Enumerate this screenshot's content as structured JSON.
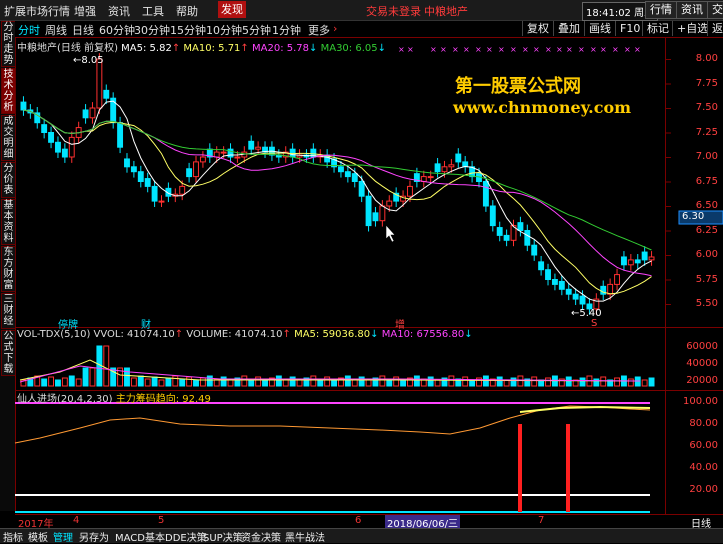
{
  "menubar": {
    "items": [
      "扩展市场行情",
      "增强",
      "资讯",
      "工具",
      "帮助"
    ],
    "active_item": "发现",
    "login_notice": "交易未登录",
    "stock_name_title": "中粮地产",
    "clock": "18:41:02",
    "weekday": "周三",
    "buttons": [
      "行情",
      "资讯",
      "交"
    ]
  },
  "periodbar": {
    "periods": [
      "分时",
      "周线",
      "日线",
      "60分钟",
      "30分钟",
      "15分钟",
      "10分钟",
      "5分钟",
      "1分钟",
      "更多"
    ],
    "selected": "日线",
    "buttons": [
      "复权",
      "叠加",
      "画线",
      "F10",
      "标记",
      "+自选",
      "返回"
    ]
  },
  "left_tabs": [
    "分时走势",
    "技术分析",
    "成交明细",
    "分价表",
    "基本资料",
    "东方财富",
    "三财经",
    "公式下载"
  ],
  "main_legend": {
    "title": "中粮地产(日线 前复权)",
    "ma5": "MA5: 5.82",
    "ma10": "MA10: 5.71",
    "ma20": "MA20: 5.78",
    "ma30": "MA30: 6.05"
  },
  "vol_legend": {
    "title": "VOL-TDX(5,10)",
    "vvol": "VVOL: 41074.10",
    "volume": "VOLUME: 41074.10",
    "ma5": "MA5: 59036.80",
    "ma10": "MA10: 67556.80"
  },
  "ind_legend": {
    "title": "仙人进场(20,4,2,30)",
    "sub": "主力筹码趋向: 92.49"
  },
  "annotations": {
    "high_label": "8.05",
    "low_label": "5.40",
    "current_price": "6.30",
    "event_1": "停牌",
    "event_2": "财",
    "event_3": "增",
    "signal_s": "S"
  },
  "watermark": {
    "line1": "第一股票公式网",
    "line2": "www.chnmoney.com"
  },
  "price_axis": [
    "8.00",
    "7.75",
    "7.50",
    "7.25",
    "7.00",
    "6.75",
    "6.50",
    "6.25",
    "6.00",
    "5.75",
    "5.50"
  ],
  "vol_axis": [
    "60000",
    "40000",
    "20000"
  ],
  "ind_axis": [
    "100.00",
    "80.00",
    "60.00",
    "40.00",
    "20.00"
  ],
  "datebar": {
    "labels": [
      "2017年",
      "4",
      "5",
      "6",
      "7"
    ],
    "highlight": "2018/06/06/三",
    "right_label": "日线"
  },
  "bottom_tabs": [
    "指标",
    "模板",
    "管理",
    "另存为",
    "MACD基本",
    "DDE决策",
    "SUP决策",
    "资金决策",
    "黑牛战法"
  ],
  "bottom_selected": "管理",
  "colors": {
    "up": "#ff3030",
    "down": "#00e5ff",
    "ma5": "#ffffff",
    "ma10": "#ffff66",
    "ma20": "#ff44ff",
    "ma30": "#33cc33",
    "frame": "#7a0000"
  }
}
